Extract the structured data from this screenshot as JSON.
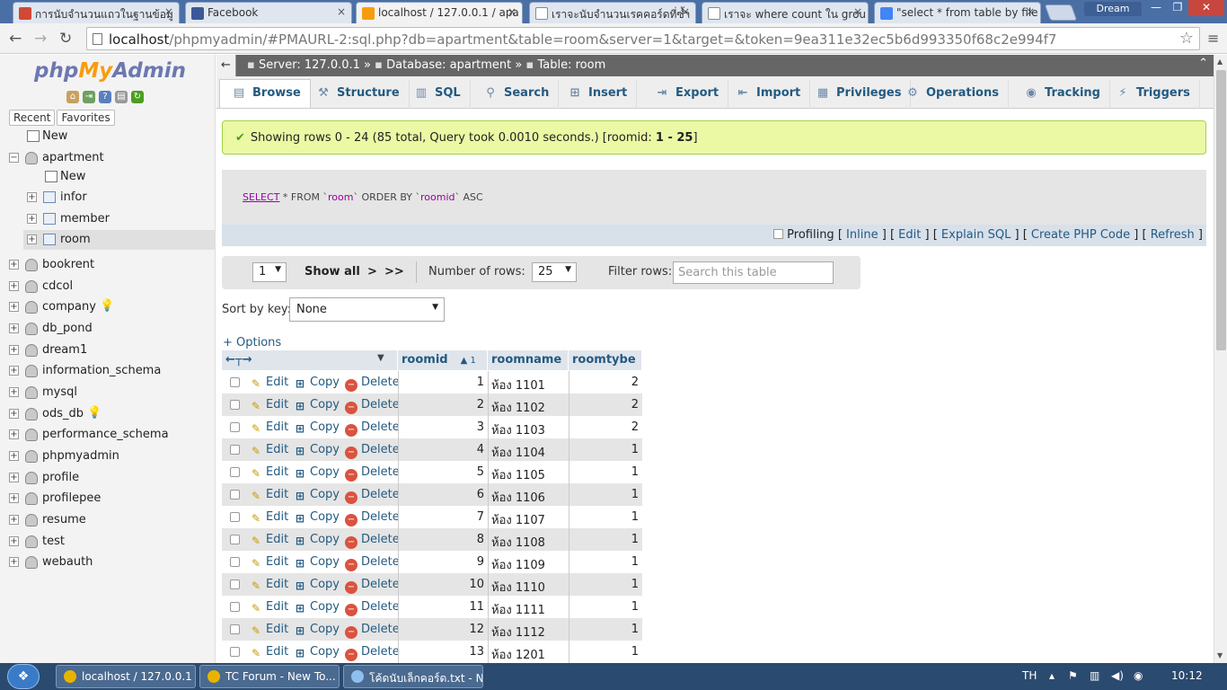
{
  "browser": {
    "tabs": [
      {
        "title": "การนับจำนวนแถวในฐานข้อมู",
        "icon": "gmail-icon",
        "color": "#d14836",
        "active": false
      },
      {
        "title": "Facebook",
        "icon": "facebook-icon",
        "color": "#3b5998",
        "active": false
      },
      {
        "title": "localhost / 127.0.0.1 / apa",
        "icon": "pma-icon",
        "color": "#f89c0e",
        "active": true
      },
      {
        "title": "เราจะนับจำนวนเรคคอร์ดที่ซ้ำ",
        "icon": "page-icon",
        "color": "#ffffff",
        "active": false
      },
      {
        "title": "เราจะ where count ใน grou",
        "icon": "page-icon",
        "color": "#ffffff",
        "active": false
      },
      {
        "title": "\"select * from table by file",
        "icon": "google-icon",
        "color": "#4285f4",
        "active": false
      }
    ],
    "close_glyph": "×",
    "window_user": "Dream",
    "window_buttons": [
      "—",
      "❐",
      "✕"
    ],
    "url_host": "localhost",
    "url_path": "/phpmyadmin/#PMAURL-2:sql.php?db=apartment&table=room&server=1&target=&token=9ea311e32ec5b6d993350f68c2e994f7"
  },
  "nav": {
    "logo_php": "php",
    "logo_my": "My",
    "logo_admin": "Admin",
    "recent_label": "Recent",
    "favorites_label": "Favorites",
    "tree": [
      {
        "label": "New",
        "level": 0,
        "kind": "new",
        "expander": "",
        "selected": false,
        "bulb": false
      },
      {
        "label": "apartment",
        "level": 0,
        "kind": "db",
        "expander": "−",
        "selected": false,
        "bulb": false
      },
      {
        "label": "New",
        "level": 1,
        "kind": "new",
        "expander": "",
        "selected": false,
        "bulb": false
      },
      {
        "label": "infor",
        "level": 1,
        "kind": "table",
        "expander": "+",
        "selected": false,
        "bulb": false
      },
      {
        "label": "member",
        "level": 1,
        "kind": "table",
        "expander": "+",
        "selected": false,
        "bulb": false
      },
      {
        "label": "room",
        "level": 1,
        "kind": "table",
        "expander": "+",
        "selected": true,
        "bulb": false
      },
      {
        "label": "bookrent",
        "level": 0,
        "kind": "db",
        "expander": "+",
        "selected": false,
        "bulb": false
      },
      {
        "label": "cdcol",
        "level": 0,
        "kind": "db",
        "expander": "+",
        "selected": false,
        "bulb": false
      },
      {
        "label": "company",
        "level": 0,
        "kind": "db",
        "expander": "+",
        "selected": false,
        "bulb": true
      },
      {
        "label": "db_pond",
        "level": 0,
        "kind": "db",
        "expander": "+",
        "selected": false,
        "bulb": false
      },
      {
        "label": "dream1",
        "level": 0,
        "kind": "db",
        "expander": "+",
        "selected": false,
        "bulb": false
      },
      {
        "label": "information_schema",
        "level": 0,
        "kind": "db",
        "expander": "+",
        "selected": false,
        "bulb": false
      },
      {
        "label": "mysql",
        "level": 0,
        "kind": "db",
        "expander": "+",
        "selected": false,
        "bulb": false
      },
      {
        "label": "ods_db",
        "level": 0,
        "kind": "db",
        "expander": "+",
        "selected": false,
        "bulb": true
      },
      {
        "label": "performance_schema",
        "level": 0,
        "kind": "db",
        "expander": "+",
        "selected": false,
        "bulb": false
      },
      {
        "label": "phpmyadmin",
        "level": 0,
        "kind": "db",
        "expander": "+",
        "selected": false,
        "bulb": false
      },
      {
        "label": "profile",
        "level": 0,
        "kind": "db",
        "expander": "+",
        "selected": false,
        "bulb": false
      },
      {
        "label": "profilepee",
        "level": 0,
        "kind": "db",
        "expander": "+",
        "selected": false,
        "bulb": false
      },
      {
        "label": "resume",
        "level": 0,
        "kind": "db",
        "expander": "+",
        "selected": false,
        "bulb": false
      },
      {
        "label": "test",
        "level": 0,
        "kind": "db",
        "expander": "+",
        "selected": false,
        "bulb": false
      },
      {
        "label": "webauth",
        "level": 0,
        "kind": "db",
        "expander": "+",
        "selected": false,
        "bulb": false
      }
    ]
  },
  "breadcrumb": {
    "server": "Server: 127.0.0.1",
    "database": "Database: apartment",
    "table": "Table: room",
    "sep": "»"
  },
  "tabs": [
    {
      "label": "Browse",
      "icon": "browse-icon",
      "glyph": "▤",
      "active": true
    },
    {
      "label": "Structure",
      "icon": "structure-icon",
      "glyph": "⚒",
      "active": false
    },
    {
      "label": "SQL",
      "icon": "sql-icon",
      "glyph": "▥",
      "active": false
    },
    {
      "label": "Search",
      "icon": "search-icon",
      "glyph": "⚲",
      "active": false
    },
    {
      "label": "Insert",
      "icon": "insert-icon",
      "glyph": "⊞",
      "active": false
    },
    {
      "label": "Export",
      "icon": "export-icon",
      "glyph": "⇥",
      "active": false
    },
    {
      "label": "Import",
      "icon": "import-icon",
      "glyph": "⇤",
      "active": false
    },
    {
      "label": "Privileges",
      "icon": "privileges-icon",
      "glyph": "▦",
      "active": false
    },
    {
      "label": "Operations",
      "icon": "operations-icon",
      "glyph": "⚙",
      "active": false
    },
    {
      "label": "Tracking",
      "icon": "tracking-icon",
      "glyph": "◉",
      "active": false
    },
    {
      "label": "Triggers",
      "icon": "triggers-icon",
      "glyph": "⚡",
      "active": false
    }
  ],
  "message": {
    "text": "Showing rows 0 - 24 (85 total, Query took 0.0010 seconds.) [roomid: ",
    "range": "1 - 25",
    "close": "]"
  },
  "sql": {
    "select": "SELECT",
    "rest_a": " * FROM `",
    "table": "room",
    "rest_b": "` ORDER BY `",
    "col": "roomid",
    "rest_c": "` ASC"
  },
  "sqllinks": {
    "profiling": "Profiling",
    "links": [
      "Inline",
      "Edit",
      "Explain SQL",
      "Create PHP Code",
      "Refresh"
    ]
  },
  "pager": {
    "page": "1",
    "show_all": "Show all",
    "next": ">",
    "last": ">>",
    "rows_label": "Number of rows:",
    "rows_value": "25",
    "filter_label": "Filter rows:",
    "filter_placeholder": "Search this table"
  },
  "sort": {
    "label": "Sort by key:",
    "value": "None"
  },
  "options_label": "+ Options",
  "table": {
    "columns": [
      {
        "label": "roomid",
        "sort": "▲ 1"
      },
      {
        "label": "roomname",
        "sort": ""
      },
      {
        "label": "roomtybe",
        "sort": ""
      }
    ],
    "actions": {
      "edit": "Edit",
      "copy": "Copy",
      "delete": "Delete"
    },
    "rows": [
      {
        "roomid": "1",
        "roomname": "ห้อง 1101",
        "roomtybe": "2"
      },
      {
        "roomid": "2",
        "roomname": "ห้อง 1102",
        "roomtybe": "2"
      },
      {
        "roomid": "3",
        "roomname": "ห้อง 1103",
        "roomtybe": "2"
      },
      {
        "roomid": "4",
        "roomname": "ห้อง 1104",
        "roomtybe": "1"
      },
      {
        "roomid": "5",
        "roomname": "ห้อง 1105",
        "roomtybe": "1"
      },
      {
        "roomid": "6",
        "roomname": "ห้อง 1106",
        "roomtybe": "1"
      },
      {
        "roomid": "7",
        "roomname": "ห้อง 1107",
        "roomtybe": "1"
      },
      {
        "roomid": "8",
        "roomname": "ห้อง 1108",
        "roomtybe": "1"
      },
      {
        "roomid": "9",
        "roomname": "ห้อง 1109",
        "roomtybe": "1"
      },
      {
        "roomid": "10",
        "roomname": "ห้อง 1110",
        "roomtybe": "1"
      },
      {
        "roomid": "11",
        "roomname": "ห้อง 1111",
        "roomtybe": "1"
      },
      {
        "roomid": "12",
        "roomname": "ห้อง 1112",
        "roomtybe": "1"
      },
      {
        "roomid": "13",
        "roomname": "ห้อง 1201",
        "roomtybe": "1"
      }
    ]
  },
  "taskbar": {
    "items": [
      {
        "label": "localhost / 127.0.0.1 ...",
        "icon": "chrome-icon",
        "color": "#e8b400"
      },
      {
        "label": "TC Forum - New To...",
        "icon": "chrome-icon",
        "color": "#e8b400"
      },
      {
        "label": "โค้ดนับเล็กคอร์ด.txt - N...",
        "icon": "notepad-icon",
        "color": "#8fbfef"
      }
    ],
    "lang": "TH",
    "clock": "10:12"
  },
  "colors": {
    "link": "#235a81",
    "success_bg": "#ebf8a4",
    "accent_orange": "#f89c0e"
  }
}
